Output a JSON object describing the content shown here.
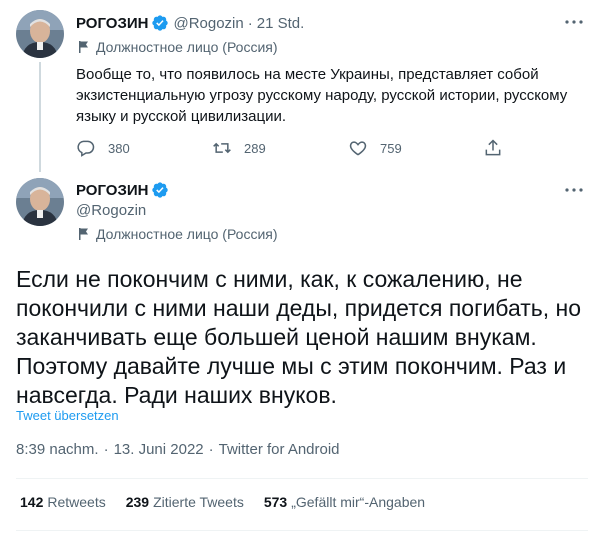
{
  "reply_tweet": {
    "author_name": "РОГОЗИН",
    "handle": "@Rogozin",
    "separator": "·",
    "time": "21 Std.",
    "label": "Должностное лицо (Россия)",
    "text": "Вообще то, что появилось на месте Украины, представляет собой экзистенциальную угрозу русскому народу, русской истории, русскому языку и русской цивилизации.",
    "replies": "380",
    "retweets": "289",
    "likes": "759"
  },
  "main_tweet": {
    "author_name": "РОГОЗИН",
    "handle": "@Rogozin",
    "label": "Должностное лицо (Россия)",
    "text": "Если не покончим с ними, как, к сожалению, не покончили с ними наши деды, придется погибать, но заканчивать еще большей ценой нашим внукам. Поэтому давайте лучше мы с этим покончим. Раз и навсегда. Ради наших внуков.",
    "translate_link": "Tweet übersetzen",
    "time": "8:39 nachm.",
    "separator": "·",
    "date": "13. Juni 2022",
    "source": "Twitter for Android",
    "stats": [
      {
        "count": "142",
        "label": "Retweets"
      },
      {
        "count": "239",
        "label": "Zitierte Tweets"
      },
      {
        "count": "573",
        "label": "„Gefällt mir“-Angaben"
      }
    ]
  },
  "icons": {
    "verified": "verified-badge-icon",
    "more": "more-icon",
    "flag": "flag-icon",
    "reply": "reply-icon",
    "retweet": "retweet-icon",
    "like": "like-icon",
    "share": "share-icon"
  },
  "colors": {
    "accent": "#1d9bf0",
    "text": "#0f1419",
    "secondary": "#536471"
  }
}
